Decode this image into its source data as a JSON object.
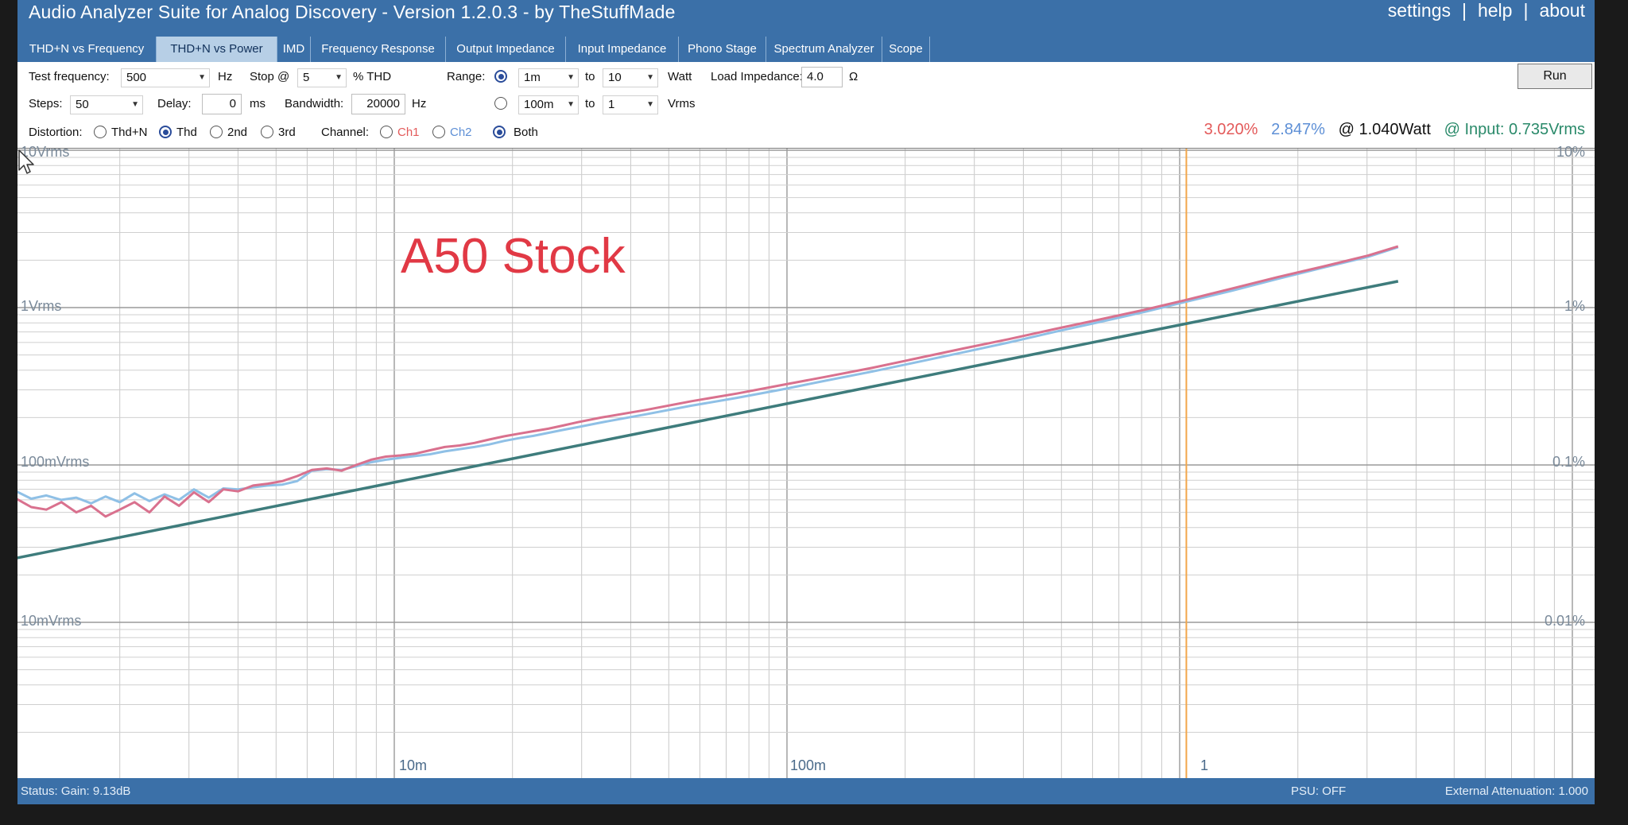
{
  "window": {
    "title": "Audio Analyzer Suite for Analog Discovery - Version   1.2.0.3   - by TheStuffMade",
    "links": {
      "settings": "settings",
      "help": "help",
      "about": "about",
      "separator": "|"
    }
  },
  "tabs": [
    {
      "label": "THD+N vs Frequency",
      "active": false
    },
    {
      "label": "THD+N vs Power",
      "active": true
    },
    {
      "label": "IMD",
      "active": false
    },
    {
      "label": "Frequency Response",
      "active": false
    },
    {
      "label": "Output Impedance",
      "active": false
    },
    {
      "label": "Input Impedance",
      "active": false
    },
    {
      "label": "Phono Stage",
      "active": false
    },
    {
      "label": "Spectrum Analyzer",
      "active": false
    },
    {
      "label": "Scope",
      "active": false
    }
  ],
  "controls": {
    "test_frequency_label": "Test frequency:",
    "test_frequency_value": "500",
    "hz_unit": "Hz",
    "stop_label": "Stop @",
    "stop_value": "5",
    "stop_unit": "% THD",
    "range_label": "Range:",
    "range_watt_from": "1m",
    "range_watt_to": "10",
    "range_watt_unit": "Watt",
    "range_vrms_from": "100m",
    "range_vrms_to": "1",
    "range_vrms_unit": "Vrms",
    "to_label": "to",
    "load_impedance_label": "Load Impedance:",
    "load_impedance_value": "4.0",
    "ohm_unit": "Ω",
    "run_label": "Run",
    "steps_label": "Steps:",
    "steps_value": "50",
    "delay_label": "Delay:",
    "delay_value": "0",
    "ms_unit": "ms",
    "bandwidth_label": "Bandwidth:",
    "bandwidth_value": "20000",
    "distortion_label": "Distortion:",
    "distortion_options": [
      "Thd+N",
      "Thd",
      "2nd",
      "3rd"
    ],
    "distortion_selected": "Thd",
    "channel_label": "Channel:",
    "channel_options": [
      "Ch1",
      "Ch2",
      "Both"
    ],
    "channel_selected": "Both"
  },
  "readout": {
    "ch1": "3.020%",
    "ch2": "2.847%",
    "power": "@ 1.040Watt",
    "input": "@ Input: 0.735Vrms"
  },
  "colors": {
    "titlebar": "#3b70a8",
    "ch1": "#e35a5a",
    "ch2": "#5d8fd6",
    "input_curve": "#2a8a6a",
    "trace_ch1": "#d9718e",
    "trace_ch2": "#8fc0e6",
    "trace_input": "#3e7c7c",
    "cursor_line": "#f2a64a",
    "annotation": "#e13945"
  },
  "chart_data": {
    "type": "line",
    "x_scale": "log",
    "y_scale": "log",
    "xlim": [
      0.001,
      5
    ],
    "y_left_ticks": [
      "10Vrms",
      "1Vrms",
      "100mVrms",
      "10mVrms"
    ],
    "y_right_ticks": [
      "10%",
      "1%",
      "0.1%",
      "0.01%"
    ],
    "ylim_percent": [
      0.001,
      10
    ],
    "x_ticks": [
      {
        "value": 0.01,
        "label": "10m"
      },
      {
        "value": 0.1,
        "label": "100m"
      },
      {
        "value": 1,
        "label": "1"
      }
    ],
    "annotation": "A50  Stock",
    "cursor_x": 1.04,
    "grid": true,
    "series": [
      {
        "key": "ch1",
        "points": [
          [
            0.001,
            0.059
          ],
          [
            0.00109,
            0.061
          ],
          [
            0.00119,
            0.054
          ],
          [
            0.0013,
            0.052
          ],
          [
            0.00142,
            0.058
          ],
          [
            0.00155,
            0.05
          ],
          [
            0.00169,
            0.055
          ],
          [
            0.00184,
            0.047
          ],
          [
            0.002,
            0.052
          ],
          [
            0.00218,
            0.058
          ],
          [
            0.00238,
            0.05
          ],
          [
            0.0026,
            0.063
          ],
          [
            0.00283,
            0.055
          ],
          [
            0.00309,
            0.067
          ],
          [
            0.00337,
            0.058
          ],
          [
            0.00367,
            0.07
          ],
          [
            0.004,
            0.068
          ],
          [
            0.00437,
            0.074
          ],
          [
            0.00476,
            0.076
          ],
          [
            0.00519,
            0.079
          ],
          [
            0.00566,
            0.085
          ],
          [
            0.00617,
            0.093
          ],
          [
            0.00673,
            0.095
          ],
          [
            0.00734,
            0.092
          ],
          [
            0.008,
            0.1
          ],
          [
            0.00873,
            0.108
          ],
          [
            0.00952,
            0.113
          ],
          [
            0.01038,
            0.115
          ],
          [
            0.01131,
            0.118
          ],
          [
            0.01234,
            0.124
          ],
          [
            0.01345,
            0.13
          ],
          [
            0.01467,
            0.133
          ],
          [
            0.016,
            0.138
          ],
          [
            0.01745,
            0.145
          ],
          [
            0.01903,
            0.152
          ],
          [
            0.02075,
            0.158
          ],
          [
            0.02262,
            0.164
          ],
          [
            0.02467,
            0.17
          ],
          [
            0.0269,
            0.178
          ],
          [
            0.02934,
            0.187
          ],
          [
            0.0336,
            0.2
          ],
          [
            0.0438,
            0.224
          ],
          [
            0.0571,
            0.254
          ],
          [
            0.0745,
            0.284
          ],
          [
            0.0972,
            0.322
          ],
          [
            0.1268,
            0.365
          ],
          [
            0.1655,
            0.415
          ],
          [
            0.2159,
            0.478
          ],
          [
            0.2817,
            0.55
          ],
          [
            0.3675,
            0.63
          ],
          [
            0.4795,
            0.73
          ],
          [
            0.6256,
            0.84
          ],
          [
            0.8162,
            0.97
          ],
          [
            1.04,
            1.12
          ],
          [
            1.358,
            1.32
          ],
          [
            1.771,
            1.56
          ],
          [
            2.311,
            1.82
          ],
          [
            3.015,
            2.14
          ],
          [
            3.6,
            2.45
          ]
        ]
      },
      {
        "key": "ch2",
        "points": [
          [
            0.001,
            0.064
          ],
          [
            0.00109,
            0.068
          ],
          [
            0.00119,
            0.061
          ],
          [
            0.0013,
            0.064
          ],
          [
            0.00142,
            0.06
          ],
          [
            0.00155,
            0.062
          ],
          [
            0.00169,
            0.057
          ],
          [
            0.00184,
            0.063
          ],
          [
            0.002,
            0.058
          ],
          [
            0.00218,
            0.066
          ],
          [
            0.00238,
            0.059
          ],
          [
            0.0026,
            0.065
          ],
          [
            0.00283,
            0.06
          ],
          [
            0.00309,
            0.07
          ],
          [
            0.00337,
            0.062
          ],
          [
            0.00367,
            0.071
          ],
          [
            0.004,
            0.07
          ],
          [
            0.00437,
            0.072
          ],
          [
            0.00476,
            0.074
          ],
          [
            0.00519,
            0.075
          ],
          [
            0.00566,
            0.079
          ],
          [
            0.00617,
            0.092
          ],
          [
            0.00673,
            0.094
          ],
          [
            0.00734,
            0.093
          ],
          [
            0.008,
            0.098
          ],
          [
            0.00873,
            0.104
          ],
          [
            0.00952,
            0.108
          ],
          [
            0.01038,
            0.111
          ],
          [
            0.01131,
            0.114
          ],
          [
            0.01234,
            0.117
          ],
          [
            0.01345,
            0.122
          ],
          [
            0.01467,
            0.126
          ],
          [
            0.016,
            0.13
          ],
          [
            0.01745,
            0.135
          ],
          [
            0.01903,
            0.142
          ],
          [
            0.02075,
            0.148
          ],
          [
            0.02262,
            0.153
          ],
          [
            0.02467,
            0.16
          ],
          [
            0.0269,
            0.167
          ],
          [
            0.02934,
            0.174
          ],
          [
            0.0336,
            0.186
          ],
          [
            0.0438,
            0.21
          ],
          [
            0.0571,
            0.238
          ],
          [
            0.0745,
            0.267
          ],
          [
            0.0972,
            0.302
          ],
          [
            0.1268,
            0.345
          ],
          [
            0.1655,
            0.393
          ],
          [
            0.2159,
            0.452
          ],
          [
            0.2817,
            0.52
          ],
          [
            0.3675,
            0.6
          ],
          [
            0.4795,
            0.7
          ],
          [
            0.6256,
            0.81
          ],
          [
            0.8162,
            0.94
          ],
          [
            1.04,
            1.09
          ],
          [
            1.358,
            1.28
          ],
          [
            1.771,
            1.52
          ],
          [
            2.311,
            1.79
          ],
          [
            3.015,
            2.1
          ],
          [
            3.6,
            2.42
          ]
        ]
      },
      {
        "key": "input",
        "points": [
          [
            0.001,
            0.0245
          ],
          [
            0.01,
            0.0775
          ],
          [
            0.1,
            0.245
          ],
          [
            1,
            0.775
          ],
          [
            3.6,
            1.47
          ]
        ]
      }
    ]
  },
  "status": {
    "left": "Status: Gain: 9.13dB",
    "psu": "PSU: OFF",
    "attenuation": "External Attenuation: 1.000"
  }
}
